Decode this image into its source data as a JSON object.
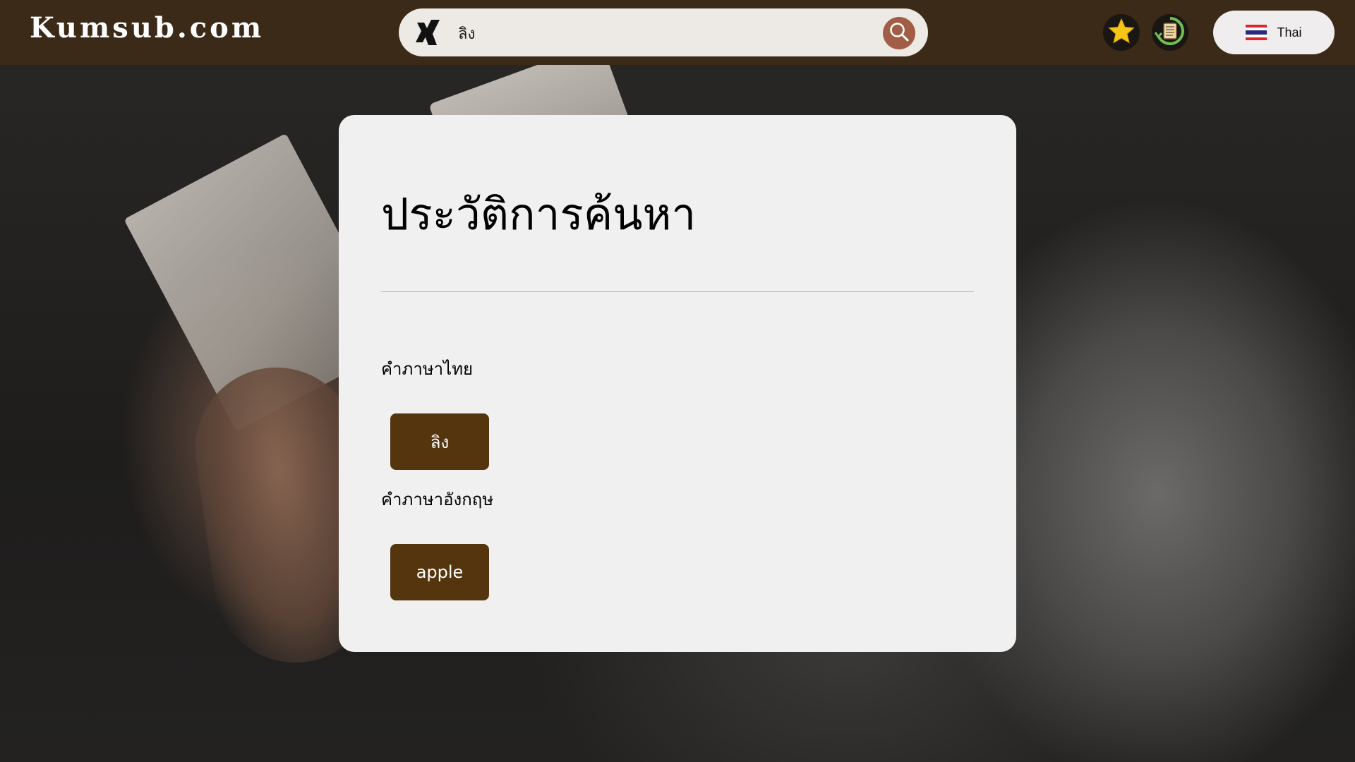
{
  "header": {
    "logo": "Kumsub.com",
    "search": {
      "value": "ลิง",
      "placeholder": ""
    },
    "icons": {
      "search_mode": "xing-x-icon",
      "search": "search-icon",
      "favorites": "star-icon",
      "history": "history-scroll-icon"
    },
    "language": {
      "flag": "thailand-flag-icon",
      "label": "Thai"
    }
  },
  "history_card": {
    "title": "ประวัติการค้นหา",
    "thai_section": {
      "label": "คำภาษาไทย",
      "words": [
        "ลิง"
      ]
    },
    "english_section": {
      "label": "คำภาษาอังกฤษ",
      "words": [
        "apple"
      ]
    }
  },
  "colors": {
    "header_bg": "#3b2a17",
    "accent_button": "#54350e",
    "search_button": "#a25d47",
    "card_bg": "#f0f0f0"
  }
}
